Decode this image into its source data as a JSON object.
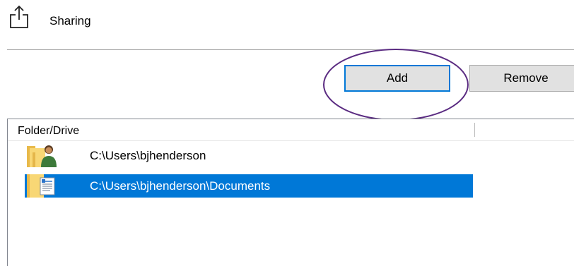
{
  "header": {
    "title": "Sharing",
    "icon": "share-icon"
  },
  "toolbar": {
    "add_label": "Add",
    "remove_label": "Remove"
  },
  "list": {
    "column_header": "Folder/Drive",
    "items": [
      {
        "path": "C:\\Users\\bjhenderson",
        "icon": "user-folder-icon",
        "selected": false
      },
      {
        "path": "C:\\Users\\bjhenderson\\Documents",
        "icon": "documents-folder-icon",
        "selected": true
      }
    ]
  },
  "colors": {
    "accent": "#0078d7",
    "highlight_circle": "#5b2c82",
    "button_bg": "#e1e1e1",
    "folder_yellow": "#f8d775"
  }
}
